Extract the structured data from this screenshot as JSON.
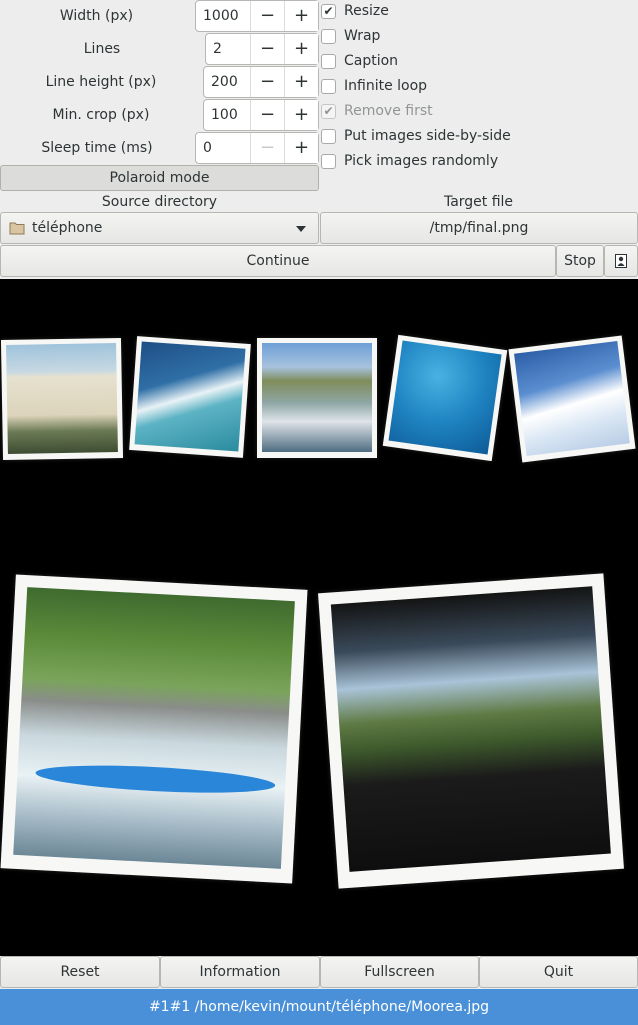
{
  "settings": {
    "width": {
      "label": "Width (px)",
      "value": "1000"
    },
    "lines": {
      "label": "Lines",
      "value": "2"
    },
    "line_height": {
      "label": "Line height (px)",
      "value": "200"
    },
    "min_crop": {
      "label": "Min. crop (px)",
      "value": "100"
    },
    "sleep_time": {
      "label": "Sleep time (ms)",
      "value": "0"
    },
    "minus": "−",
    "plus": "+"
  },
  "options": {
    "resize": {
      "label": "Resize",
      "checked": true
    },
    "wrap": {
      "label": "Wrap",
      "checked": false
    },
    "caption": {
      "label": "Caption",
      "checked": false
    },
    "infinite_loop": {
      "label": "Infinite loop",
      "checked": false
    },
    "remove_first": {
      "label": "Remove first",
      "checked": true,
      "disabled": true
    },
    "side_by_side": {
      "label": "Put images side-by-side",
      "checked": false
    },
    "pick_random": {
      "label": "Pick images randomly",
      "checked": false
    }
  },
  "polaroid_button": "Polaroid mode",
  "source": {
    "label": "Source directory",
    "value": "téléphone"
  },
  "target": {
    "label": "Target file",
    "value": "/tmp/final.png"
  },
  "actions": {
    "continue": "Continue",
    "stop": "Stop"
  },
  "bottom_buttons": {
    "reset": "Reset",
    "information": "Information",
    "fullscreen": "Fullscreen",
    "quit": "Quit"
  },
  "status": "#1#1 /home/kevin/mount/téléphone/Moorea.jpg",
  "colors": {
    "status_bar": "#4a90d9",
    "viewer_bg": "#000000"
  }
}
